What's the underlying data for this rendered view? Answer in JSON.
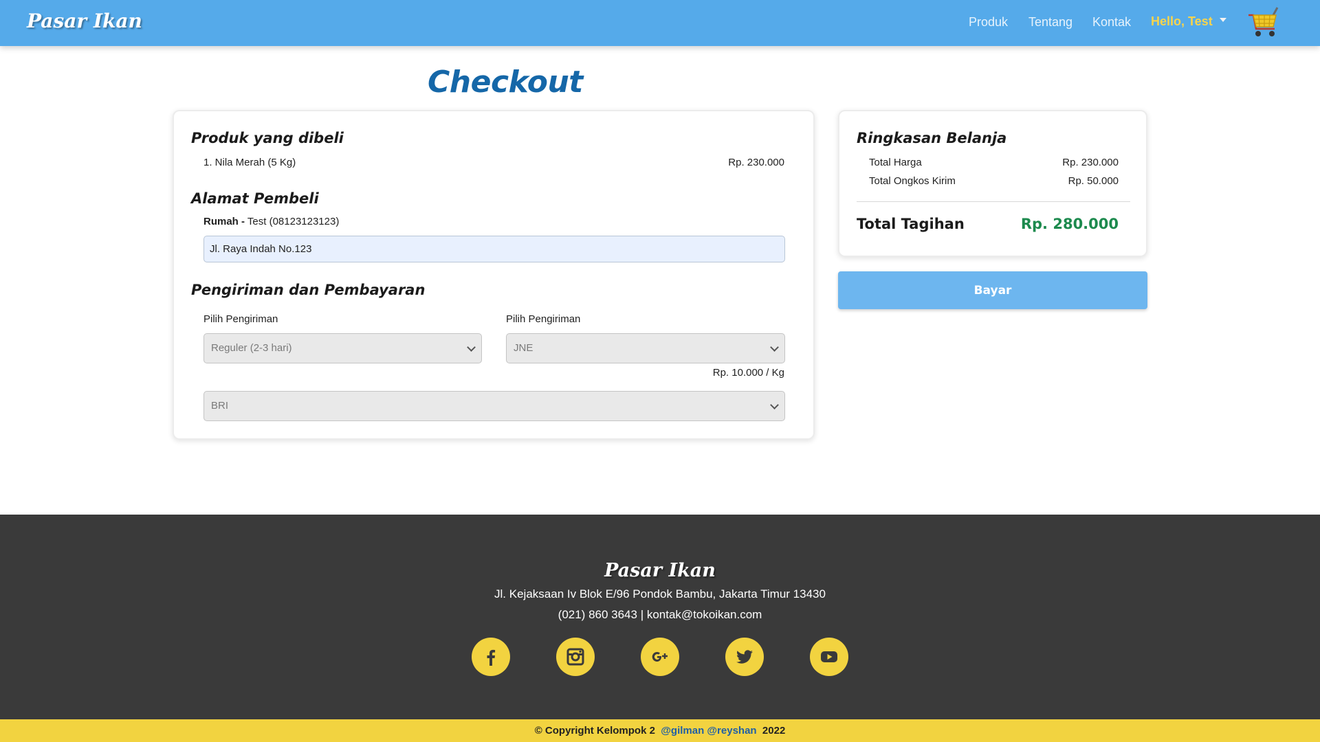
{
  "navbar": {
    "brand": "Pasar Ikan",
    "links": [
      "Produk",
      "Tentang",
      "Kontak"
    ],
    "user_label": "Hello, Test",
    "cart_icon": "cart-icon"
  },
  "page": {
    "title": "Checkout"
  },
  "products": {
    "heading": "Produk yang dibeli",
    "items": [
      {
        "name": "1. Nila Merah (5 Kg)",
        "price": "Rp. 230.000"
      }
    ]
  },
  "address": {
    "heading": "Alamat Pembeli",
    "label_bold": "Rumah -",
    "label_rest": " Test (08123123123)",
    "value": "Jl. Raya Indah No.123"
  },
  "shipping": {
    "heading": "Pengiriman dan Pembayaran",
    "service_label": "Pilih Pengiriman",
    "service_value": "Reguler (2-3 hari)",
    "courier_label": "Pilih Pengiriman",
    "courier_value": "JNE",
    "rate": "Rp. 10.000 / Kg",
    "payment_value": "BRI"
  },
  "summary": {
    "heading": "Ringkasan Belanja",
    "rows": [
      {
        "label": "Total Harga",
        "value": "Rp. 230.000"
      },
      {
        "label": "Total Ongkos Kirim",
        "value": "Rp. 50.000"
      }
    ],
    "total_label": "Total Tagihan",
    "total_value": "Rp. 280.000",
    "total_color": "#1d8a4e"
  },
  "pay_button": "Bayar",
  "footer": {
    "brand": "Pasar Ikan",
    "address": "Jl. Kejaksaan Iv Blok E/96 Pondok Bambu, Jakarta Timur 13430",
    "contact": "(021) 860 3643 | kontak@tokoikan.com",
    "socials": [
      "facebook-icon",
      "instagram-icon",
      "google-plus-icon",
      "twitter-icon",
      "youtube-icon"
    ]
  },
  "copyright": {
    "prefix": "© Copyright Kelompok 2",
    "handles": "@gilman @reyshan",
    "year": "2022"
  },
  "colors": {
    "navbar": "#55aaea",
    "accent_yellow": "#f2d340",
    "title_blue": "#1567a8",
    "footer_bg": "#3a3a3a",
    "pay_button": "#6db6ef"
  }
}
